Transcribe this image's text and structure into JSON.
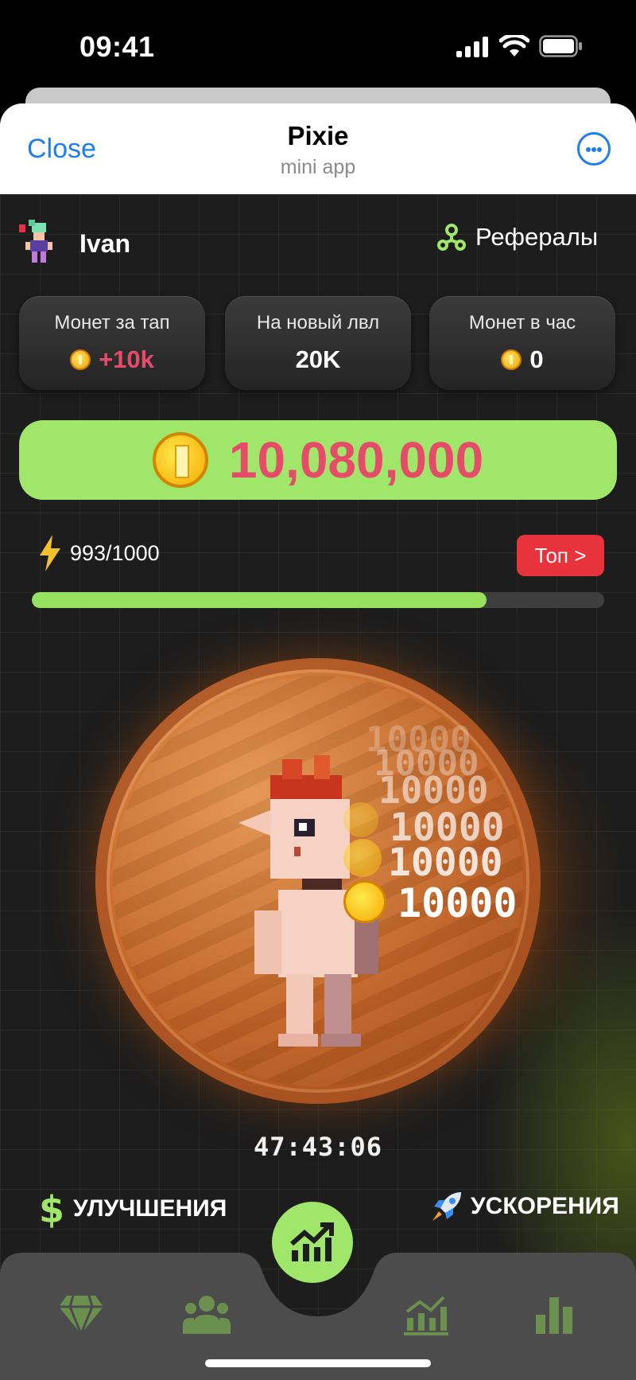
{
  "status_bar": {
    "time": "09:41"
  },
  "header": {
    "close_label": "Close",
    "title": "Pixie",
    "subtitle": "mini app"
  },
  "profile": {
    "username": "Ivan",
    "referrals_label": "Рефералы"
  },
  "stats": [
    {
      "label": "Монет за тап",
      "value": "+10k",
      "value_color": "#e64c6a",
      "coin": true
    },
    {
      "label": "На новый лвл",
      "value": "20K",
      "coin": false
    },
    {
      "label": "Монет в час",
      "value": "0",
      "coin": true
    }
  ],
  "balance": {
    "amount": "10,080,000",
    "amount_color": "#e64c6a",
    "background": "#a0e66a"
  },
  "energy": {
    "text": "993/1000",
    "current": 993,
    "max": 1000,
    "top_button": "Топ >"
  },
  "tap_popups": [
    "10000",
    "10000",
    "10000",
    "10000",
    "10000",
    "10000"
  ],
  "timer": "47:43:06",
  "actions": {
    "upgrades_label": "УЛУЧШЕНИЯ",
    "boosts_label": "УСКОРЕНИЯ"
  },
  "nav": {
    "items": [
      {
        "icon": "gem-icon"
      },
      {
        "icon": "users-icon"
      },
      {
        "icon": "chart-up-icon"
      },
      {
        "icon": "stats-icon"
      },
      {
        "icon": "bar-chart-icon"
      }
    ]
  },
  "colors": {
    "accent_green": "#a0e66a",
    "accent_red": "#e8323c",
    "link_blue": "#1e7ef0"
  }
}
